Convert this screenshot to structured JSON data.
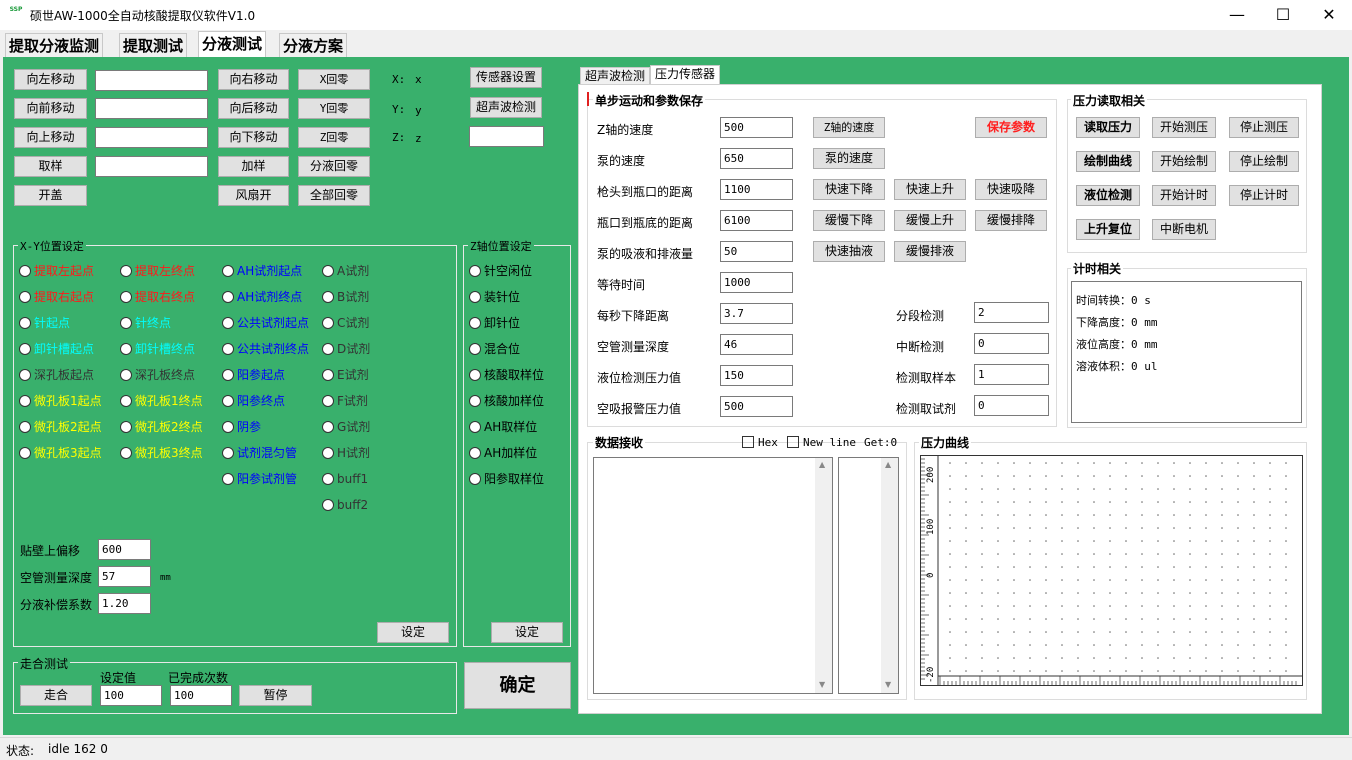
{
  "window": {
    "title": "硕世AW-1000全自动核酸提取仪软件V1.0",
    "logo_text": "SSP",
    "minimize": "—",
    "maximize": "☐",
    "close": "✕"
  },
  "tabs": [
    "提取分液监测",
    "提取测试",
    "分液测试",
    "分液方案"
  ],
  "left_controls": {
    "btn_left": "向左移动",
    "btn_right": "向右移动",
    "btn_x_zero": "X回零",
    "btn_fwd": "向前移动",
    "btn_back": "向后移动",
    "btn_y_zero": "Y回零",
    "btn_up": "向上移动",
    "btn_down": "向下移动",
    "btn_z_zero": "Z回零",
    "btn_sample": "取样",
    "btn_add_sample": "加样",
    "btn_dispense_zero": "分液回零",
    "btn_open_lid": "开盖",
    "btn_fan_on": "风扇开",
    "btn_all_zero": "全部回零",
    "x_label": "X:",
    "x_value": "x",
    "y_label": "Y:",
    "y_value": "y",
    "z_label": "Z:",
    "z_value": "z",
    "btn_sensor_settings": "传感器设置",
    "btn_ultrasonic_detect": "超声波检测"
  },
  "xy_group": {
    "title": "X-Y位置设定",
    "col1": [
      "提取左起点",
      "提取右起点",
      "针起点",
      "卸针槽起点",
      "深孔板起点",
      "微孔板1起点",
      "微孔板2起点",
      "微孔板3起点"
    ],
    "col2": [
      "提取左终点",
      "提取右终点",
      "针终点",
      "卸针槽终点",
      "深孔板终点",
      "微孔板1终点",
      "微孔板2终点",
      "微孔板3终点"
    ],
    "col3": [
      "AH试剂起点",
      "AH试剂终点",
      "公共试剂起点",
      "公共试剂终点",
      "阳参起点",
      "阳参终点",
      "阴参",
      "试剂混匀管",
      "阳参试剂管"
    ],
    "col4": [
      "A试剂",
      "B试剂",
      "C试剂",
      "D试剂",
      "E试剂",
      "F试剂",
      "G试剂",
      "H试剂",
      "buff1",
      "buff2"
    ],
    "offset_label": "贴壁上偏移",
    "offset_value": "600",
    "empty_depth_label": "空管测量深度",
    "empty_depth_value": "57",
    "unit_mm": "mm",
    "comp_label": "分液补偿系数",
    "comp_value": "1.20",
    "set_btn": "设定"
  },
  "z_group": {
    "title": "Z轴位置设定",
    "items": [
      "针空闲位",
      "装针位",
      "卸针位",
      "混合位",
      "核酸取样位",
      "核酸加样位",
      "AH取样位",
      "AH加样位",
      "阳参取样位"
    ],
    "set_btn": "设定"
  },
  "walk_test": {
    "title": "走合测试",
    "set_label": "设定值",
    "done_label": "已完成次数",
    "btn_walk": "走合",
    "set_value": "100",
    "done_value": "100",
    "btn_pause": "暂停"
  },
  "confirm_btn": "确定",
  "subtabs": [
    "超声波检测",
    "压力传感器"
  ],
  "step_group": {
    "title": "单步运动和参数保存",
    "rows": [
      {
        "label": "Z轴的速度",
        "value": "500"
      },
      {
        "label": "泵的速度",
        "value": "650"
      },
      {
        "label": "枪头到瓶口的距离",
        "value": "1100"
      },
      {
        "label": "瓶口到瓶底的距离",
        "value": "6100"
      },
      {
        "label": "泵的吸液和排液量",
        "value": "50"
      },
      {
        "label": "等待时间",
        "value": "1000"
      },
      {
        "label": "每秒下降距离",
        "value": "3.7"
      },
      {
        "label": "空管测量深度",
        "value": "46"
      },
      {
        "label": "液位检测压力值",
        "value": "150"
      },
      {
        "label": "空吸报警压力值",
        "value": "500"
      }
    ],
    "btn_z_speed": "Z轴的速度",
    "btn_save": "保存参数",
    "btn_pump_speed": "泵的速度",
    "btn_fast_down": "快速下降",
    "btn_fast_up": "快速上升",
    "btn_fast_suck": "快速吸降",
    "btn_slow_down": "缓慢下降",
    "btn_slow_up": "缓慢上升",
    "btn_slow_drain": "缓慢排降",
    "btn_fast_pump": "快速抽液",
    "btn_slow_discharge": "缓慢排液",
    "seg_label": "分段检测",
    "seg_value": "2",
    "interrupt_label": "中断检测",
    "interrupt_value": "0",
    "sample_label": "检测取样本",
    "sample_value": "1",
    "reagent_label": "检测取试剂",
    "reagent_value": "0"
  },
  "pressure_group": {
    "title": "压力读取相关",
    "btn_read": "读取压力",
    "btn_start_measure": "开始测压",
    "btn_stop_measure": "停止测压",
    "btn_draw": "绘制曲线",
    "btn_start_draw": "开始绘制",
    "btn_stop_draw": "停止绘制",
    "btn_level": "液位检测",
    "btn_start_timer": "开始计时",
    "btn_stop_timer": "停止计时",
    "btn_reset": "上升复位",
    "btn_stop_motor": "中断电机"
  },
  "timer_group": {
    "title": "计时相关",
    "lines": [
      "时间转换：0 s",
      "下降高度：0 mm",
      "液位高度：0 mm",
      "溶液体积：0 ul"
    ]
  },
  "data_recv": {
    "title": "数据接收",
    "hex_label": "Hex",
    "newline_label": "New line",
    "get_label": "Get:0"
  },
  "pressure_curve": {
    "title": "压力曲线",
    "y_ticks": [
      "200",
      "100",
      "0",
      "-20"
    ]
  },
  "status": {
    "label": "状态:",
    "text": "idle  162 0"
  }
}
